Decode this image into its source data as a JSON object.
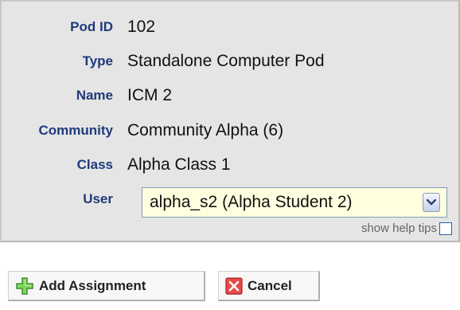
{
  "fields": [
    {
      "label": "Pod ID",
      "value": "102"
    },
    {
      "label": "Type",
      "value": "Standalone Computer Pod"
    },
    {
      "label": "Name",
      "value": "ICM 2"
    },
    {
      "label": "Community",
      "value": "Community Alpha (6)"
    },
    {
      "label": "Class",
      "value": "Alpha Class 1"
    }
  ],
  "user": {
    "label": "User",
    "selected": "alpha_s2 (Alpha Student 2)"
  },
  "help_tips": {
    "label": "show help tips",
    "checked": false
  },
  "buttons": {
    "add_label": "Add Assignment",
    "cancel_label": "Cancel"
  },
  "icons": {
    "add": "plus-icon",
    "cancel": "close-icon",
    "dropdown": "chevron-down-icon"
  },
  "colors": {
    "label": "#1f3a7a",
    "panel_bg": "#e5e5e5",
    "select_bg": "#ffffe0",
    "add_icon": "#6fcf4a",
    "cancel_icon": "#e23b3b"
  }
}
